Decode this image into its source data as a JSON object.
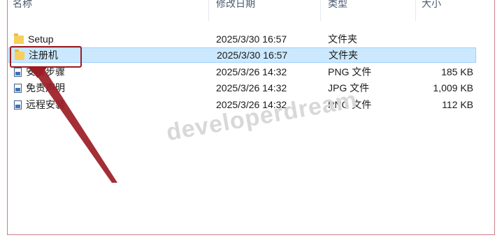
{
  "columns": {
    "name": "名称",
    "date": "修改日期",
    "type": "类型",
    "size": "大小"
  },
  "files": [
    {
      "name": "Setup",
      "date": "2025/3/30 16:57",
      "type": "文件夹",
      "size": "",
      "icon": "folder-icon"
    },
    {
      "name": "注册机",
      "date": "2025/3/30 16:57",
      "type": "文件夹",
      "size": "",
      "icon": "folder-icon",
      "selected": true
    },
    {
      "name": "安装步骤",
      "date": "2025/3/26 14:32",
      "type": "PNG 文件",
      "size": "185 KB",
      "icon": "image-icon"
    },
    {
      "name": "免责声明",
      "date": "2025/3/26 14:32",
      "type": "JPG 文件",
      "size": "1,009 KB",
      "icon": "image-icon"
    },
    {
      "name": "远程安装",
      "date": "2025/3/26 14:32",
      "type": "PNG 文件",
      "size": "112 KB",
      "icon": "image-icon"
    }
  ],
  "watermark": "developerdream",
  "colors": {
    "selection": "#cce8ff",
    "highlight": "#9b1c24",
    "folder": "#f6cf5c"
  }
}
